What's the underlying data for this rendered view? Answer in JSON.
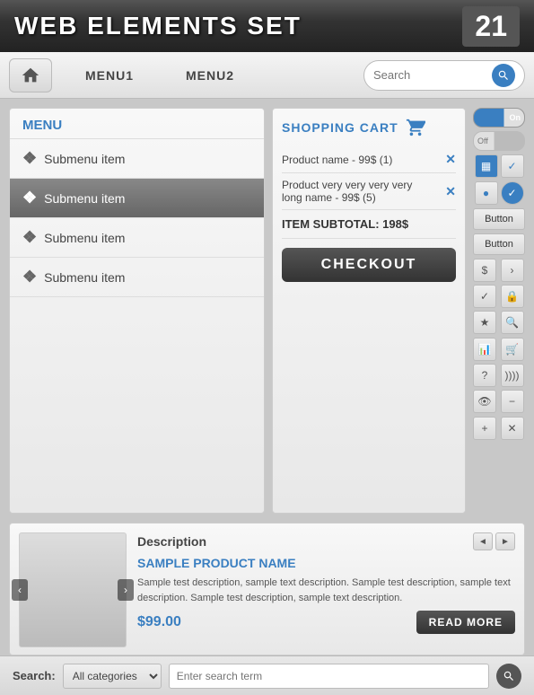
{
  "header": {
    "title": "WEB ELEMENTS SET",
    "number": "21"
  },
  "navbar": {
    "home_label": "Home",
    "menu1_label": "MENU1",
    "menu2_label": "MENU2",
    "search_placeholder": "Search"
  },
  "menu": {
    "title": "MENU",
    "items": [
      {
        "label": "Submenu item",
        "active": false
      },
      {
        "label": "Submenu item",
        "active": true
      },
      {
        "label": "Submenu item",
        "active": false
      },
      {
        "label": "Submenu item",
        "active": false
      }
    ]
  },
  "cart": {
    "title": "SHOPPING CART",
    "items": [
      {
        "name": "Product name - 99$ (1)"
      },
      {
        "name": "Product very very very very long name - 99$ (5)"
      }
    ],
    "subtotal_label": "ITEM SUBTOTAL: 198$",
    "checkout_label": "CHECKOUT"
  },
  "sidebar": {
    "toggle_on": "On",
    "toggle_off": "Off",
    "button1": "Button",
    "button2": "Button"
  },
  "product": {
    "desc_label": "Description",
    "name": "SAMPLE PRODUCT NAME",
    "text": "Sample test description, sample text description. Sample test description, sample text description. Sample test description, sample text description.",
    "price": "$99.00",
    "read_more_label": "READ MORE"
  },
  "search_bar": {
    "label": "Search:",
    "select_default": "All categories",
    "input_placeholder": "Enter search term"
  }
}
